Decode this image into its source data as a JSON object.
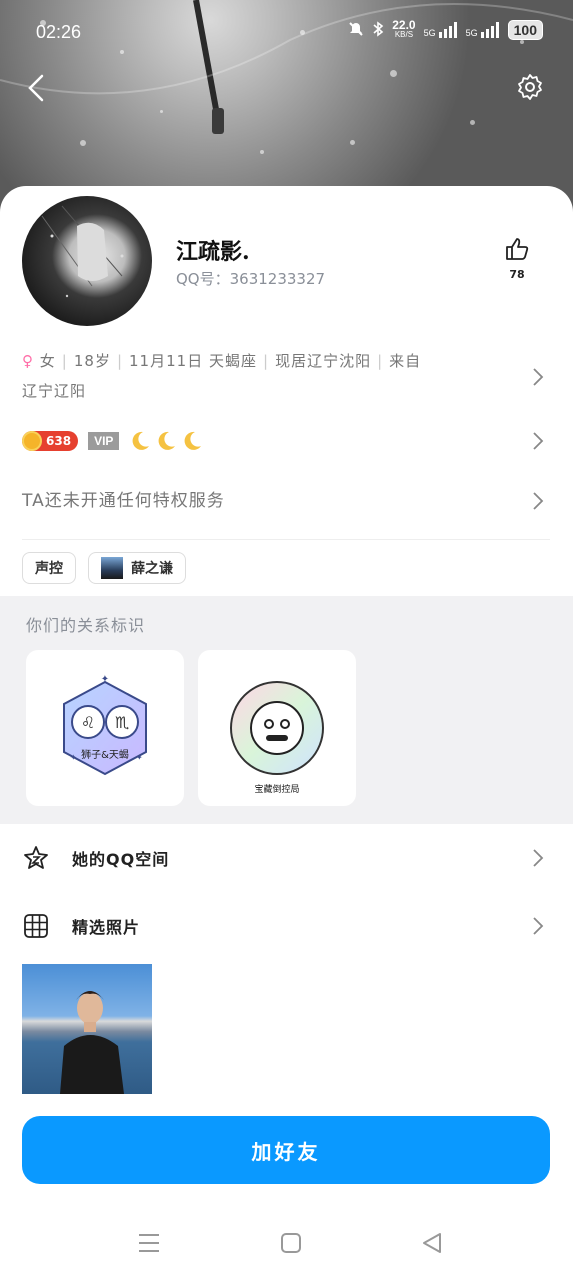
{
  "status_bar": {
    "time": "02:26",
    "network_speed": "22.0",
    "network_unit": "KB/S",
    "signal_1": "5G",
    "signal_2": "5G",
    "battery": "100"
  },
  "profile": {
    "name": "江疏影.",
    "qq_number": "QQ号：3631233327",
    "like_count": "78"
  },
  "info": {
    "gender": "女",
    "age": "18岁",
    "birthday": "11月11日",
    "zodiac": "天蝎座",
    "location": "现居辽宁沈阳",
    "hometown_line1": "来自",
    "hometown_line2": "辽宁辽阳"
  },
  "badges": {
    "coin_value": "638",
    "vip_label": "VIP"
  },
  "privilege_text": "TA还未开通任何特权服务",
  "tags": [
    {
      "label": "声控"
    },
    {
      "label": "薛之谦"
    }
  ],
  "relation": {
    "title": "你们的关系标识",
    "cards": [
      {
        "label": "狮子&天蝎"
      },
      {
        "label": "宝藏倒控局"
      }
    ]
  },
  "menu": {
    "qzone": "她的QQ空间",
    "photos": "精选照片"
  },
  "add_friend_label": "加好友",
  "colors": {
    "accent": "#0a99ff",
    "female": "#ff6ea8",
    "coin": "#e6402f",
    "moon": "#f5c241"
  }
}
